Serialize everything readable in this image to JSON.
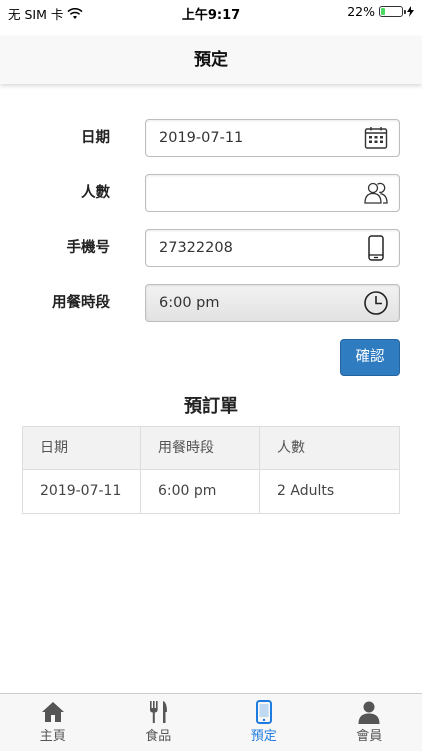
{
  "status_bar": {
    "carrier": "无 SIM 卡",
    "time": "上午9:17",
    "battery": "22%",
    "battery_level": 0.22
  },
  "header": {
    "title": "預定"
  },
  "form": {
    "date": {
      "label": "日期",
      "value": "2019-07-11",
      "icon": "calendar-icon"
    },
    "people": {
      "label": "人數",
      "value": "",
      "icon": "people-icon"
    },
    "phone": {
      "label": "手機号",
      "value": "27322208",
      "icon": "phone-icon"
    },
    "time": {
      "label": "用餐時段",
      "value": "6:00 pm",
      "icon": "clock-icon"
    }
  },
  "confirm_label": "確認",
  "orders": {
    "title": "預訂單",
    "columns": [
      "日期",
      "用餐時段",
      "人數"
    ],
    "rows": [
      [
        "2019-07-11",
        "6:00 pm",
        "2 Adults"
      ]
    ]
  },
  "tabs": [
    {
      "label": "主頁",
      "icon": "home-icon",
      "active": false
    },
    {
      "label": "食品",
      "icon": "utensils-icon",
      "active": false
    },
    {
      "label": "預定",
      "icon": "mobile-icon",
      "active": true
    },
    {
      "label": "會員",
      "icon": "user-icon",
      "active": false
    }
  ],
  "colors": {
    "accent": "#2f7cc1",
    "tab_active": "#1e7be0"
  }
}
